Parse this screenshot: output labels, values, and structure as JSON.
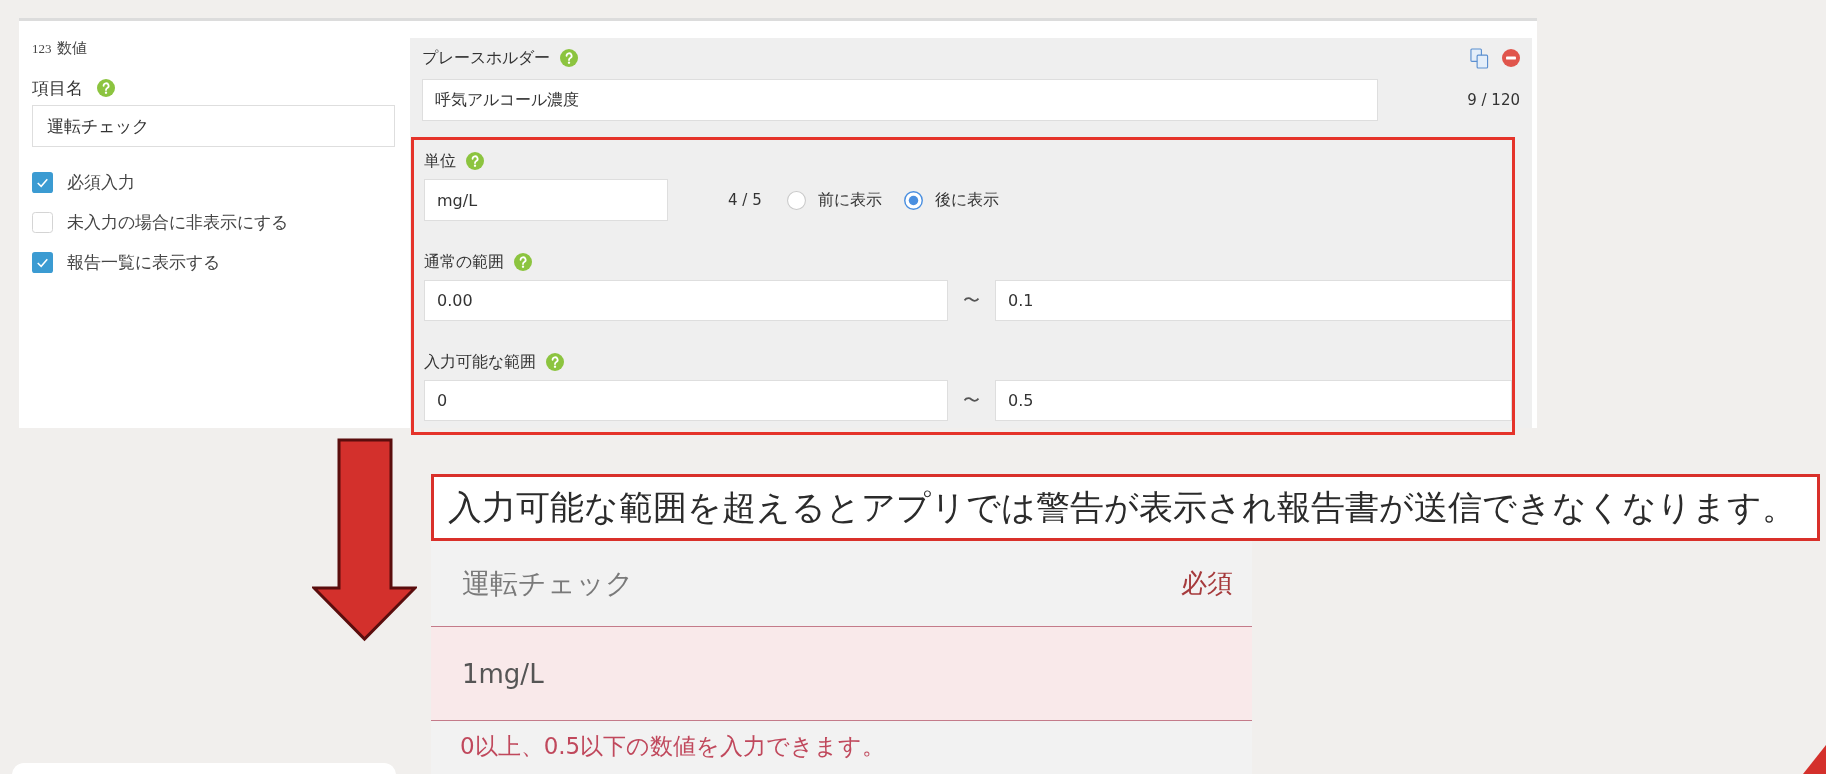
{
  "field_editor": {
    "field_type": {
      "icon_text": "123",
      "label": "数値"
    },
    "item_name": {
      "label": "項目名",
      "value": "運転チェック"
    },
    "options": [
      {
        "label": "必須入力",
        "checked": true
      },
      {
        "label": "未入力の場合に非表示にする",
        "checked": false
      },
      {
        "label": "報告一覧に表示する",
        "checked": true
      }
    ],
    "placeholder_setting": {
      "label": "プレースホルダー",
      "value": "呼気アルコール濃度",
      "counter": "9 / 120"
    },
    "unit": {
      "label": "単位",
      "value": "mg/L",
      "counter": "4 / 5",
      "positions": [
        {
          "label": "前に表示",
          "selected": false
        },
        {
          "label": "後に表示",
          "selected": true
        }
      ]
    },
    "ranges": [
      {
        "label": "通常の範囲",
        "min": "0.00",
        "separator": "〜",
        "max": "0.1"
      },
      {
        "label": "入力可能な範囲",
        "min": "0",
        "separator": "〜",
        "max": "0.5"
      }
    ]
  },
  "callout": {
    "text": "入力可能な範囲を超えるとアプリでは警告が表示され報告書が送信できなくなります。"
  },
  "app_preview": {
    "title": "運転チェック",
    "badge": "必須",
    "value": "1mg/L",
    "invalid": true,
    "error": "0以上、0.5以下の数値を入力できます。"
  }
}
